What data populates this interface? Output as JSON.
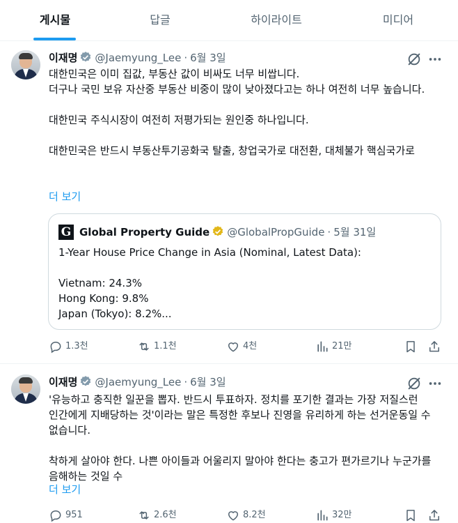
{
  "tabs": [
    {
      "label": "게시물",
      "active": true
    },
    {
      "label": "답글",
      "active": false
    },
    {
      "label": "하이라이트",
      "active": false
    },
    {
      "label": "미디어",
      "active": false
    }
  ],
  "posts": [
    {
      "author": {
        "name": "이재명",
        "handle": "@Jaemyung_Lee",
        "date": "6월 3일"
      },
      "separator": "·",
      "text": "대한민국은 이미 집값, 부동산 값이 비싸도 너무 비쌉니다.\n더구나 국민 보유 자산중 부동산 비중이 많이 낮아졌다고는 하나 여전히 너무 높습니다.\n\n대한민국 주식시장이 여전히 저평가되는 원인중 하나입니다.\n\n대한민국은 반드시 부동산투기공화국 탈출, 창업국가로 대전환, 대체불가 핵심국가로",
      "show_more": "더 보기",
      "quote": {
        "logo_letter": "G",
        "name": "Global Property Guide",
        "handle": "@GlobalPropGuide",
        "date": "5월 31일",
        "text": "1-Year House Price Change in Asia (Nominal, Latest Data):\n\nVietnam: 24.3%\nHong Kong: 9.8%\nJapan (Tokyo): 8.2%..."
      },
      "stats": {
        "replies": "1.3천",
        "reposts": "1.1천",
        "likes": "4천",
        "views": "21만"
      }
    },
    {
      "author": {
        "name": "이재명",
        "handle": "@Jaemyung_Lee",
        "date": "6월 3일"
      },
      "separator": "·",
      "text": "'유능하고 충직한 일꾼을 뽑자. 반드시 투표하자. 정치를 포기한 결과는 가장 저질스런 인간에게 지배당하는 것'이라는 말은 특정한 후보나 진영을 유리하게 하는 선거운동일 수 없습니다.\n\n착하게 살아야 한다. 나쁜 아이들과 어울리지 말아야 한다는 충고가 편가르기나 누군가를 음해하는 것일 수",
      "show_more": "더 보기",
      "stats": {
        "replies": "951",
        "reposts": "2.6천",
        "likes": "8.2천",
        "views": "32만"
      }
    }
  ],
  "icons": {
    "verified": "verified-badge-icon",
    "grok": "grok-icon",
    "more": "more-icon",
    "reply": "reply-icon",
    "repost": "repost-icon",
    "like": "heart-icon",
    "views": "views-icon",
    "bookmark": "bookmark-icon",
    "share": "share-icon"
  },
  "colors": {
    "accent": "#1d9bf0",
    "muted": "#536471",
    "text": "#0f1419",
    "gold_badge": "#e2b719",
    "border": "#cfd9de"
  }
}
